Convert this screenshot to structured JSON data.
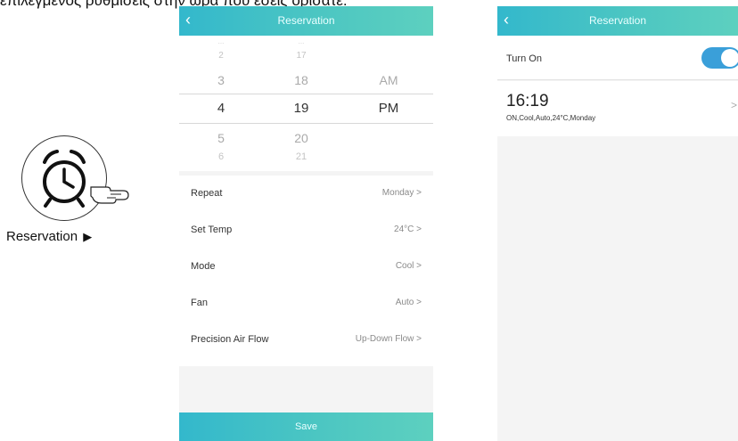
{
  "caption": "επιλεγμένος ρυθμίσεις στην ώρα που εσείς ορίσατε.",
  "illustration": {
    "label": "Reservation",
    "arrow": "▶"
  },
  "screen1": {
    "title": "Reservation",
    "back_icon": "‹",
    "picker": {
      "rows": [
        {
          "hour": "...",
          "minute": "...",
          "ampm": ""
        },
        {
          "hour": "2",
          "minute": "17",
          "ampm": ""
        },
        {
          "hour": "3",
          "minute": "18",
          "ampm": "AM"
        },
        {
          "hour": "4",
          "minute": "19",
          "ampm": "PM"
        },
        {
          "hour": "5",
          "minute": "20",
          "ampm": ""
        },
        {
          "hour": "6",
          "minute": "21",
          "ampm": ""
        }
      ],
      "selected": {
        "hour": "4",
        "minute": "19",
        "ampm": "PM"
      }
    },
    "settings": [
      {
        "label": "Repeat",
        "value": "Monday >"
      },
      {
        "label": "Set Temp",
        "value": "24°C >"
      },
      {
        "label": "Mode",
        "value": "Cool >"
      },
      {
        "label": "Fan",
        "value": "Auto >"
      },
      {
        "label": "Precision Air Flow",
        "value": "Up-Down Flow >"
      }
    ],
    "save_label": "Save"
  },
  "screen2": {
    "title": "Reservation",
    "back_icon": "‹",
    "turn_on_label": "Turn On",
    "turn_on_state": "on",
    "reservation": {
      "time": "16:19",
      "description": "ON,Cool,Auto,24°C,Monday",
      "chevron": ">"
    }
  },
  "colors": {
    "nav_gradient_start": "#33b8cc",
    "nav_gradient_end": "#5dd0bf",
    "toggle_on": "#3a9fd9"
  }
}
